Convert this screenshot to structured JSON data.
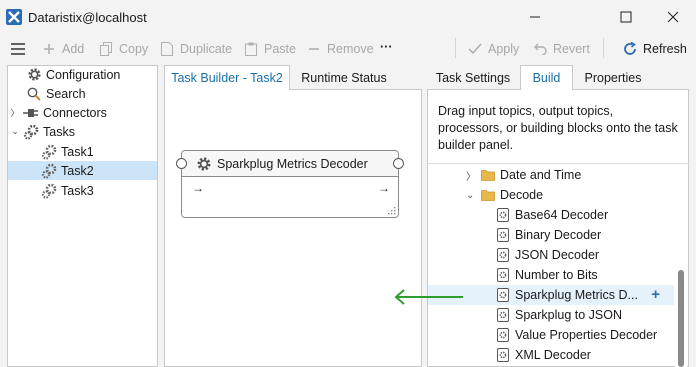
{
  "window": {
    "title": "Dataristix@localhost"
  },
  "toolbar": {
    "add": "Add",
    "copy": "Copy",
    "duplicate": "Duplicate",
    "paste": "Paste",
    "remove": "Remove",
    "more": "···",
    "apply": "Apply",
    "revert": "Revert",
    "refresh": "Refresh"
  },
  "tree": {
    "configuration": "Configuration",
    "search": "Search",
    "connectors": "Connectors",
    "tasks": "Tasks",
    "task1": "Task1",
    "task2": "Task2",
    "task3": "Task3"
  },
  "center": {
    "tab_builder": "Task Builder - Task2",
    "tab_runtime": "Runtime Status",
    "node_title": "Sparkplug Metrics Decoder",
    "in_arrow": "→",
    "out_arrow": "→"
  },
  "right": {
    "tab_settings": "Task Settings",
    "tab_build": "Build",
    "tab_properties": "Properties",
    "help": "Drag input topics, output topics, processors, or building blocks onto the task builder panel.",
    "folders": {
      "date_time": "Date and Time",
      "decode": "Decode"
    },
    "items": [
      "Base64 Decoder",
      "Binary Decoder",
      "JSON Decoder",
      "Number to Bits",
      "Sparkplug Metrics D...",
      "Sparkplug to JSON",
      "Value Properties Decoder",
      "XML Decoder"
    ],
    "add_glyph": "+"
  },
  "colors": {
    "accent": "#1a6fa8",
    "selection": "#cce4f7",
    "hover": "#e5f1fb",
    "drag_arrow": "#2e9e2e",
    "folder": "#e8b84a"
  }
}
